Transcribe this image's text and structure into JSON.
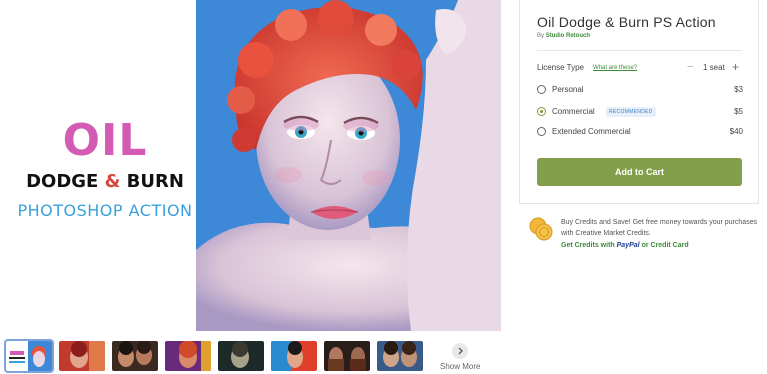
{
  "preview": {
    "brand_oil": "OIL",
    "brand_dodge": "DODGE",
    "brand_amp": "&",
    "brand_burn": "BURN",
    "brand_subtitle": "PHOTOSHOP ACTION"
  },
  "thumbnails": {
    "count": 9,
    "active_index": 0,
    "show_more_label": "Show More"
  },
  "product": {
    "title": "Oil Dodge & Burn PS Action",
    "by_prefix": "By",
    "author": "Studio Retouch"
  },
  "license": {
    "label": "License Type",
    "help_link": "What are these?",
    "seats": "1 seat",
    "options": [
      {
        "label": "Personal",
        "price": "$3",
        "checked": false,
        "badge": ""
      },
      {
        "label": "Commercial",
        "price": "$5",
        "checked": true,
        "badge": "RECOMMENDED"
      },
      {
        "label": "Extended Commercial",
        "price": "$40",
        "checked": false,
        "badge": ""
      }
    ]
  },
  "cart": {
    "button_label": "Add to Cart",
    "accent": "#82a04c"
  },
  "credits": {
    "promo_text": "Buy Credits and Save! Get free money towards your purchases with Creative Market Credits.",
    "link_prefix": "Get Credits with",
    "paypal": "PayPal",
    "link_suffix": "or Credit Card"
  },
  "colors": {
    "brand_pink": "#d35bb3",
    "brand_blue": "#3aa0dc",
    "link_green": "#3d8a3a"
  }
}
